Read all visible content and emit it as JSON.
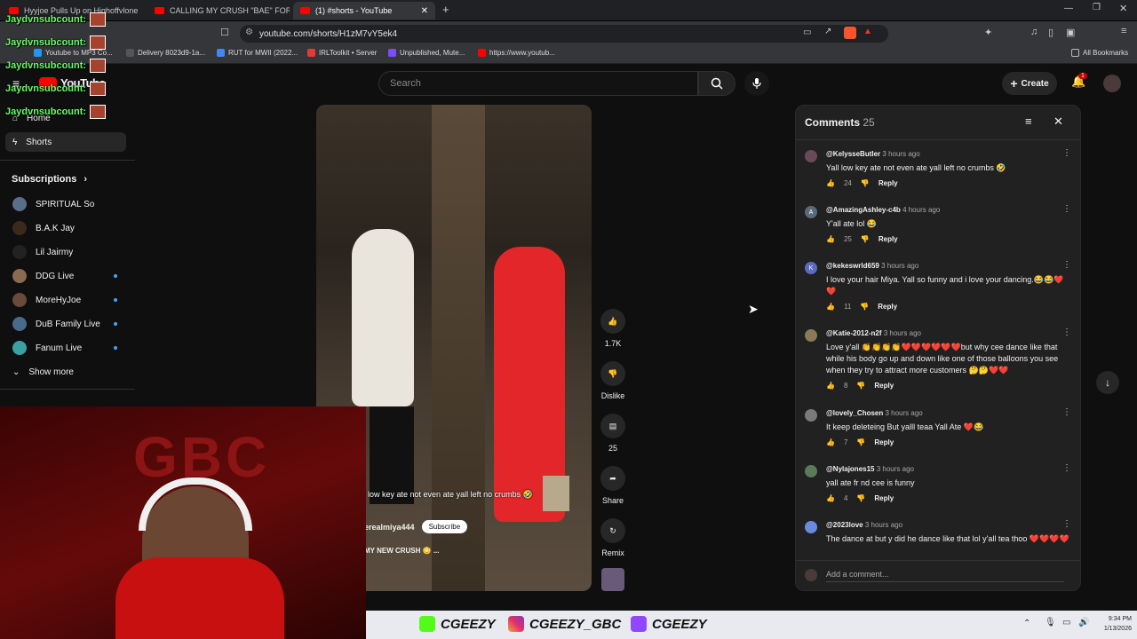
{
  "browser": {
    "tabs": [
      {
        "title": "Hyyjoe Pulls Up on Highoffvlone"
      },
      {
        "title": "CALLING MY CRUSH \"BAE\" FOR 24 H"
      },
      {
        "title": "(1) #shorts - YouTube"
      }
    ],
    "url": "youtube.com/shorts/H1zM7vY5ek4",
    "bookmarks": [
      "Youtube to MP3 Co...",
      "Delivery 8023d9-1a...",
      "RUT for MWII (2022...",
      "IRLToolkit • Server",
      "Unpublished, Mute...",
      "https://www.youtub..."
    ],
    "all_bookmarks": "All Bookmarks"
  },
  "youtube": {
    "logo": "YouTube",
    "search_placeholder": "Search",
    "create": "Create",
    "notif_count": "1",
    "sidebar": {
      "home": "Home",
      "shorts": "Shorts",
      "subscriptions": "Subscriptions",
      "channels": [
        {
          "name": "SPIRITUAL So",
          "live": false,
          "color": "#5a6e8c"
        },
        {
          "name": "B.A.K Jay",
          "live": false,
          "color": "#3a2a1c"
        },
        {
          "name": "Lil Jairmy",
          "live": false,
          "color": "#222222"
        },
        {
          "name": "DDG Live",
          "live": true,
          "color": "#8a6a50"
        },
        {
          "name": "MoreHyJoe",
          "live": true,
          "color": "#6a4a3a"
        },
        {
          "name": "DuB Family Live",
          "live": true,
          "color": "#4a6a8a"
        },
        {
          "name": "Fanum Live",
          "live": true,
          "color": "#3aa0a0"
        }
      ],
      "show_more": "Show more"
    },
    "short": {
      "caption": "low key ate not even ate yall left no crumbs 🤣",
      "channel": "erealmiya444",
      "subscribe": "Subscribe",
      "music": "MY NEW CRUSH 😳 ..."
    },
    "actions": {
      "likes": "1.7K",
      "dislike": "Dislike",
      "comments": "25",
      "share": "Share",
      "remix": "Remix"
    },
    "comments_panel": {
      "title": "Comments",
      "count": "25",
      "add_placeholder": "Add a comment...",
      "reply_label": "Reply",
      "items": [
        {
          "author": "@KelysseButler",
          "time": "3 hours ago",
          "text": "Yall low key ate not even ate yall left no crumbs 🤣",
          "likes": "24",
          "avatar": "",
          "color": "#6a4a5a"
        },
        {
          "author": "@AmazingAshley-c4b",
          "time": "4 hours ago",
          "text": "Y'all ate lol 😂",
          "likes": "25",
          "avatar": "A",
          "color": "#5a6a7a"
        },
        {
          "author": "@kekeswrld659",
          "time": "3 hours ago",
          "text": "I love your hair Miya. Yall so funny and i love your dancing.😂😂❤️❤️",
          "likes": "11",
          "avatar": "K",
          "color": "#5c6bc0"
        },
        {
          "author": "@Katie-2012-n2f",
          "time": "3 hours ago",
          "text": "Love y'all 👏👏👏👏❤️❤️❤️❤️❤️❤️but why cee dance like that while his body go up and down like one of those balloons you see when they try to attract more customers 🤔🤔❤️❤️",
          "likes": "8",
          "avatar": "",
          "color": "#8a7a5a"
        },
        {
          "author": "@lovely_Chosen",
          "time": "3 hours ago",
          "text": "It keep deleteing But yalll teaa Yall Ate ❤️😂",
          "likes": "7",
          "avatar": "",
          "color": "#7a7a7a"
        },
        {
          "author": "@Nylajones15",
          "time": "3 hours ago",
          "text": "yall ate fr nd cee is funny",
          "likes": "4",
          "avatar": "",
          "color": "#5a7a5a"
        },
        {
          "author": "@2023love",
          "time": "3 hours ago",
          "text": "The dance at but y did he dance like that lol y'all tea thoo ❤️❤️❤️❤️",
          "likes": "",
          "avatar": "",
          "color": "#6a8ae0"
        }
      ]
    }
  },
  "overlay": {
    "sub_alert": "Jaydvnsubcount:",
    "socials": [
      "CGEEZY",
      "CGEEZY_GBC",
      "CGEEZY"
    ],
    "cam_text": "GBC"
  },
  "taskbar": {
    "time": "9:34 PM",
    "date": "1/13/2026"
  }
}
